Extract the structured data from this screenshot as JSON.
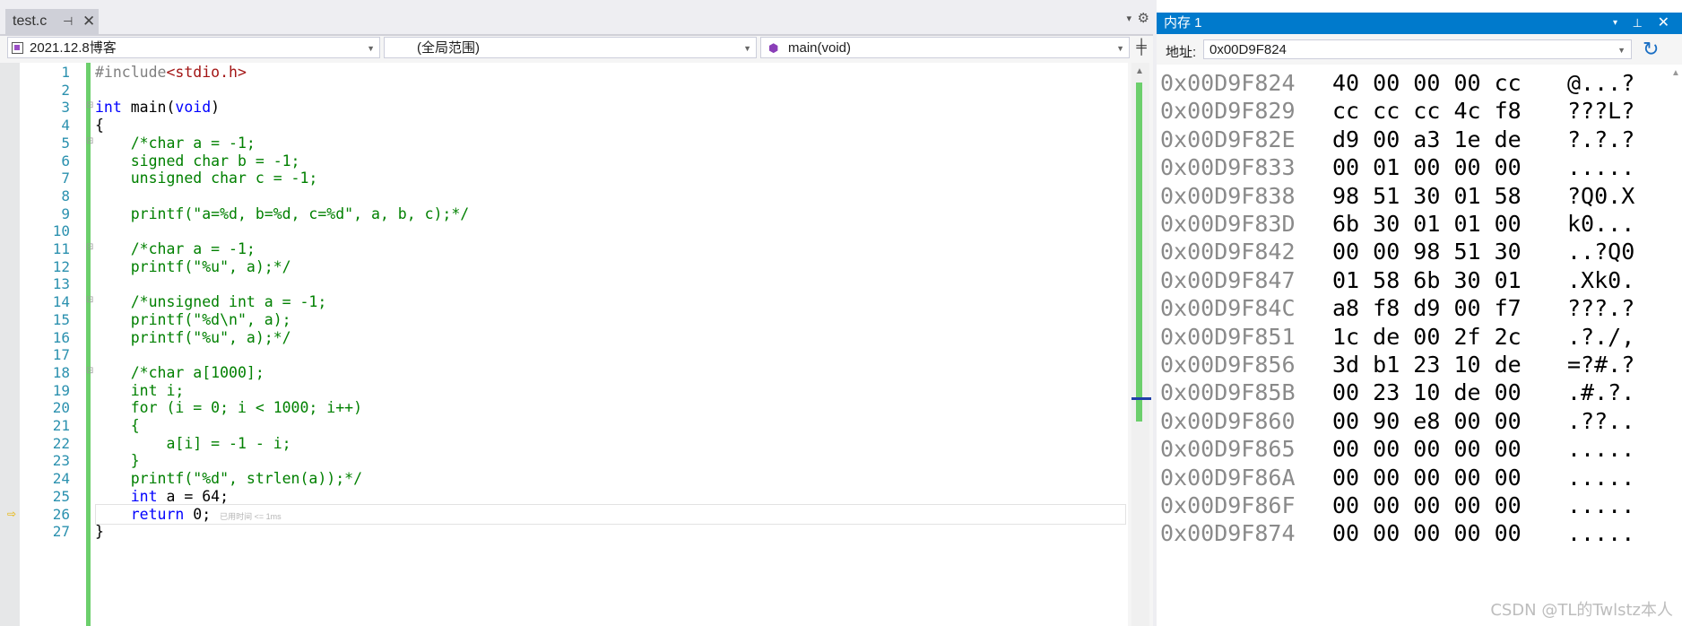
{
  "editor": {
    "tab": {
      "label": "test.c",
      "pin": "⊣",
      "close": "✕"
    },
    "tab_dropdown": "▾",
    "tab_settings": "⚙",
    "nav": {
      "project": "2021.12.8博客",
      "scope": "(全局范围)",
      "function": "main(void)",
      "split": "╪"
    },
    "lines": [
      {
        "n": "1",
        "html": "<span class=\"p\">#include</span><span class=\"s\">&lt;stdio.h&gt;</span>"
      },
      {
        "n": "2",
        "html": ""
      },
      {
        "n": "3",
        "html": "<span class=\"k\">int</span> main(<span class=\"k\">void</span>)",
        "fold": true
      },
      {
        "n": "4",
        "html": "{"
      },
      {
        "n": "5",
        "html": "    <span class=\"c\">/*char a = -1;</span>",
        "fold": true
      },
      {
        "n": "6",
        "html": "    <span class=\"c\">signed char b = -1;</span>"
      },
      {
        "n": "7",
        "html": "    <span class=\"c\">unsigned char c = -1;</span>"
      },
      {
        "n": "8",
        "html": ""
      },
      {
        "n": "9",
        "html": "    <span class=\"c\">printf(\"a=%d, b=%d, c=%d\", a, b, c);*/</span>"
      },
      {
        "n": "10",
        "html": ""
      },
      {
        "n": "11",
        "html": "    <span class=\"c\">/*char a = -1;</span>",
        "fold": true
      },
      {
        "n": "12",
        "html": "    <span class=\"c\">printf(\"%u\", a);*/</span>"
      },
      {
        "n": "13",
        "html": ""
      },
      {
        "n": "14",
        "html": "    <span class=\"c\">/*unsigned int a = -1;</span>",
        "fold": true
      },
      {
        "n": "15",
        "html": "    <span class=\"c\">printf(\"%d\\n\", a);</span>"
      },
      {
        "n": "16",
        "html": "    <span class=\"c\">printf(\"%u\", a);*/</span>"
      },
      {
        "n": "17",
        "html": ""
      },
      {
        "n": "18",
        "html": "    <span class=\"c\">/*char a[1000];</span>",
        "fold": true
      },
      {
        "n": "19",
        "html": "    <span class=\"c\">int i;</span>"
      },
      {
        "n": "20",
        "html": "    <span class=\"c\">for (i = 0; i &lt; 1000; i++)</span>"
      },
      {
        "n": "21",
        "html": "    <span class=\"c\">{</span>"
      },
      {
        "n": "22",
        "html": "        <span class=\"c\">a[i] = -1 - i;</span>"
      },
      {
        "n": "23",
        "html": "    <span class=\"c\">}</span>"
      },
      {
        "n": "24",
        "html": "    <span class=\"c\">printf(\"%d\", strlen(a));*/</span>"
      },
      {
        "n": "25",
        "html": "    <span class=\"k\">int</span> a = 64;"
      },
      {
        "n": "26",
        "html": "    <span class=\"k\">return</span> 0; <span class=\"tip\">已用时间 &lt;= 1ms</span>",
        "current": true
      },
      {
        "n": "27",
        "html": "}"
      }
    ]
  },
  "memory": {
    "title": "内存 1",
    "title_dropdown": "▾",
    "title_pin": "⊥",
    "title_close": "✕",
    "address_label": "地址:",
    "address_value": "0x00D9F824",
    "refresh": "↻",
    "rows": [
      {
        "addr": "0x00D9F824",
        "bytes": "40 00 00 00 cc",
        "ascii": "@...?"
      },
      {
        "addr": "0x00D9F829",
        "bytes": "cc cc cc 4c f8",
        "ascii": "???L?"
      },
      {
        "addr": "0x00D9F82E",
        "bytes": "d9 00 a3 1e de",
        "ascii": "?.?.?"
      },
      {
        "addr": "0x00D9F833",
        "bytes": "00 01 00 00 00",
        "ascii": "....."
      },
      {
        "addr": "0x00D9F838",
        "bytes": "98 51 30 01 58",
        "ascii": "?Q0.X"
      },
      {
        "addr": "0x00D9F83D",
        "bytes": "6b 30 01 01 00",
        "ascii": "k0..."
      },
      {
        "addr": "0x00D9F842",
        "bytes": "00 00 98 51 30",
        "ascii": "..?Q0"
      },
      {
        "addr": "0x00D9F847",
        "bytes": "01 58 6b 30 01",
        "ascii": ".Xk0."
      },
      {
        "addr": "0x00D9F84C",
        "bytes": "a8 f8 d9 00 f7",
        "ascii": "???.?"
      },
      {
        "addr": "0x00D9F851",
        "bytes": "1c de 00 2f 2c",
        "ascii": ".?./,"
      },
      {
        "addr": "0x00D9F856",
        "bytes": "3d b1 23 10 de",
        "ascii": "=?#.?"
      },
      {
        "addr": "0x00D9F85B",
        "bytes": "00 23 10 de 00",
        "ascii": ".#.?."
      },
      {
        "addr": "0x00D9F860",
        "bytes": "00 90 e8 00 00",
        "ascii": ".??.."
      },
      {
        "addr": "0x00D9F865",
        "bytes": "00 00 00 00 00",
        "ascii": "....."
      },
      {
        "addr": "0x00D9F86A",
        "bytes": "00 00 00 00 00",
        "ascii": "....."
      },
      {
        "addr": "0x00D9F86F",
        "bytes": "00 00 00 00 00",
        "ascii": "....."
      },
      {
        "addr": "0x00D9F874",
        "bytes": "00 00 00 00 00",
        "ascii": "....."
      }
    ]
  },
  "watermark": "CSDN @TL的Twlstz本人",
  "colors": {
    "accent": "#007acc",
    "keyword": "#0000ff",
    "comment": "#008000",
    "line_number": "#2b91af",
    "change_bar": "#6ccf6c"
  }
}
